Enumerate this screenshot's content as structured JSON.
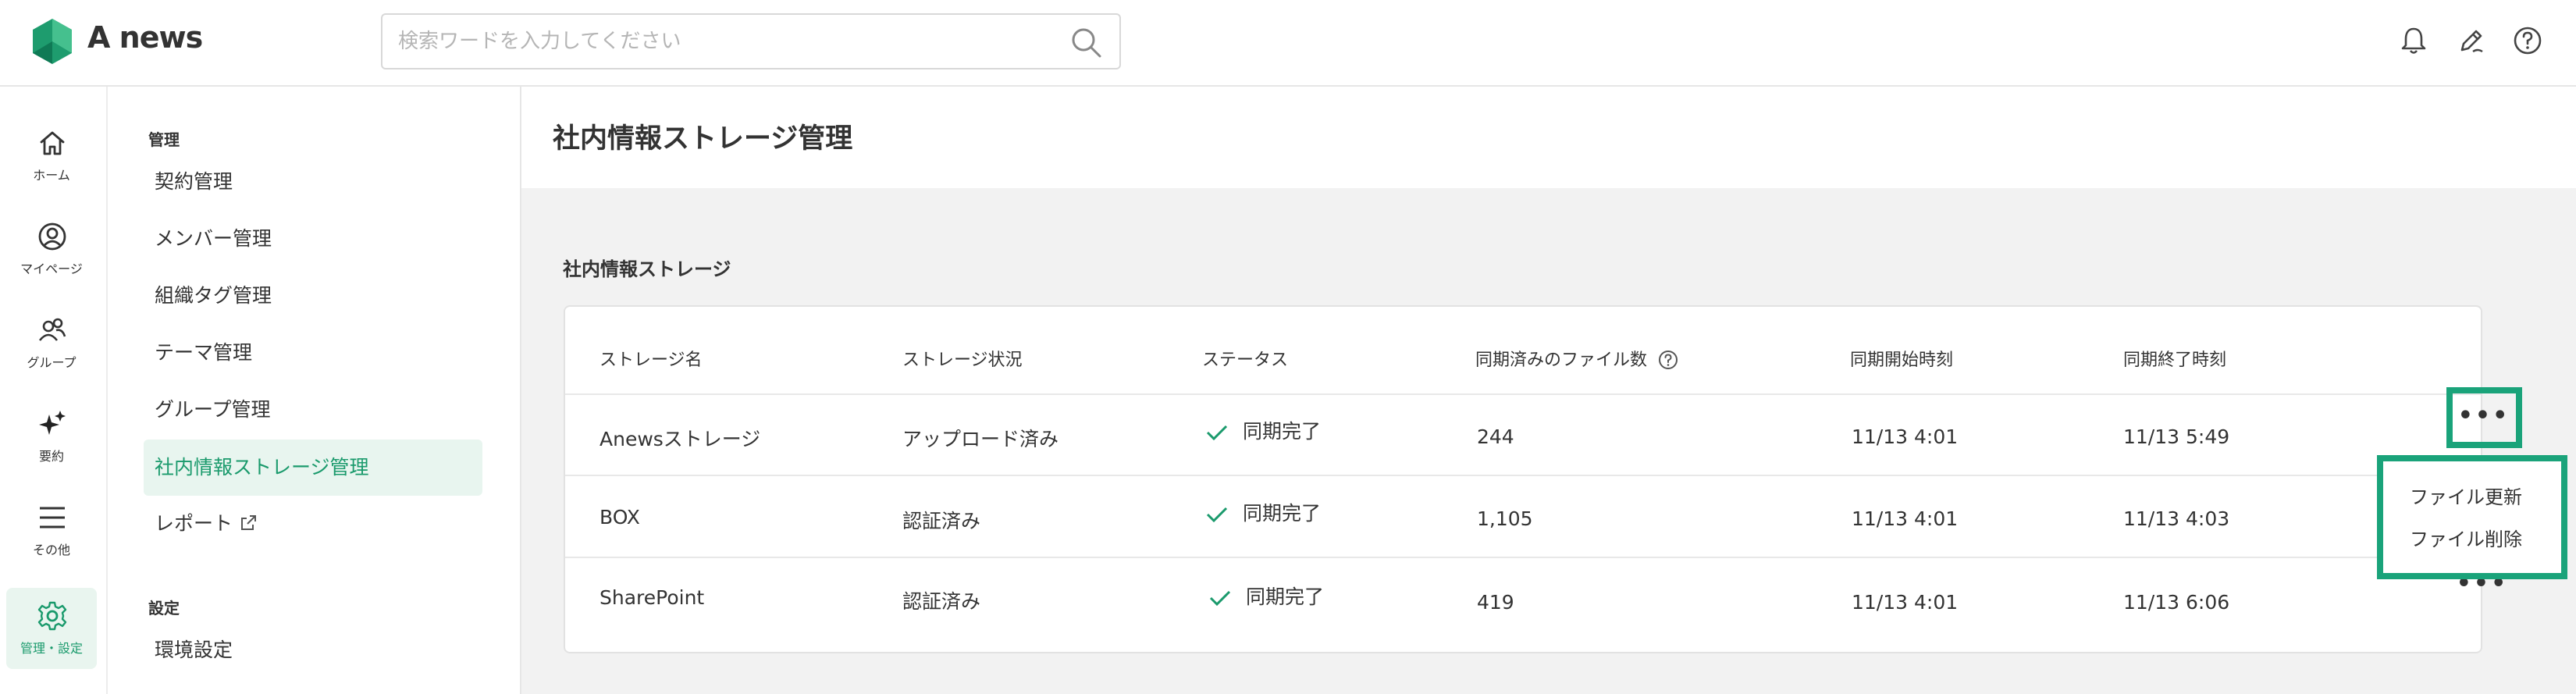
{
  "app": {
    "name": "A news"
  },
  "search": {
    "placeholder": "検索ワードを入力してください"
  },
  "header_icons": [
    "bell-icon",
    "pen-icon",
    "help-icon"
  ],
  "rail": [
    {
      "label": "ホーム",
      "icon": "home-icon"
    },
    {
      "label": "マイページ",
      "icon": "user-icon"
    },
    {
      "label": "グループ",
      "icon": "group-icon"
    },
    {
      "label": "要約",
      "icon": "sparkle-icon"
    },
    {
      "label": "その他",
      "icon": "menu-icon"
    },
    {
      "label": "管理・設定",
      "icon": "gear-icon",
      "active": true
    }
  ],
  "subnav": {
    "management_title": "管理",
    "items": [
      {
        "label": "契約管理"
      },
      {
        "label": "メンバー管理"
      },
      {
        "label": "組織タグ管理"
      },
      {
        "label": "テーマ管理"
      },
      {
        "label": "グループ管理"
      },
      {
        "label": "社内情報ストレージ管理",
        "active": true
      },
      {
        "label": "レポート",
        "external": true
      }
    ],
    "settings_title": "設定",
    "settings_items": [
      {
        "label": "環境設定"
      }
    ]
  },
  "page": {
    "title": "社内情報ストレージ管理",
    "section_title": "社内情報ストレージ"
  },
  "table": {
    "headers": [
      "ストレージ名",
      "ストレージ状況",
      "ステータス",
      "同期済みのファイル数",
      "同期開始時刻",
      "同期終了時刻"
    ],
    "rows": [
      {
        "name": "Anewsストレージ",
        "state": "アップロード済み",
        "status": "同期完了",
        "files": "244",
        "start": "11/13 4:01",
        "end": "11/13 5:49"
      },
      {
        "name": "BOX",
        "state": "認証済み",
        "status": "同期完了",
        "files": "1,105",
        "start": "11/13 4:01",
        "end": "11/13 4:03"
      },
      {
        "name": "SharePoint",
        "state": "認証済み",
        "status": "同期完了",
        "files": "419",
        "start": "11/13 4:01",
        "end": "11/13 6:06"
      }
    ],
    "more_label": "•••"
  },
  "row_menu": {
    "items": [
      "ファイル更新",
      "ファイル削除"
    ]
  },
  "colors": {
    "accent": "#1a9a6c",
    "highlight": "#1aa37a",
    "background": "#f2f2f2"
  }
}
